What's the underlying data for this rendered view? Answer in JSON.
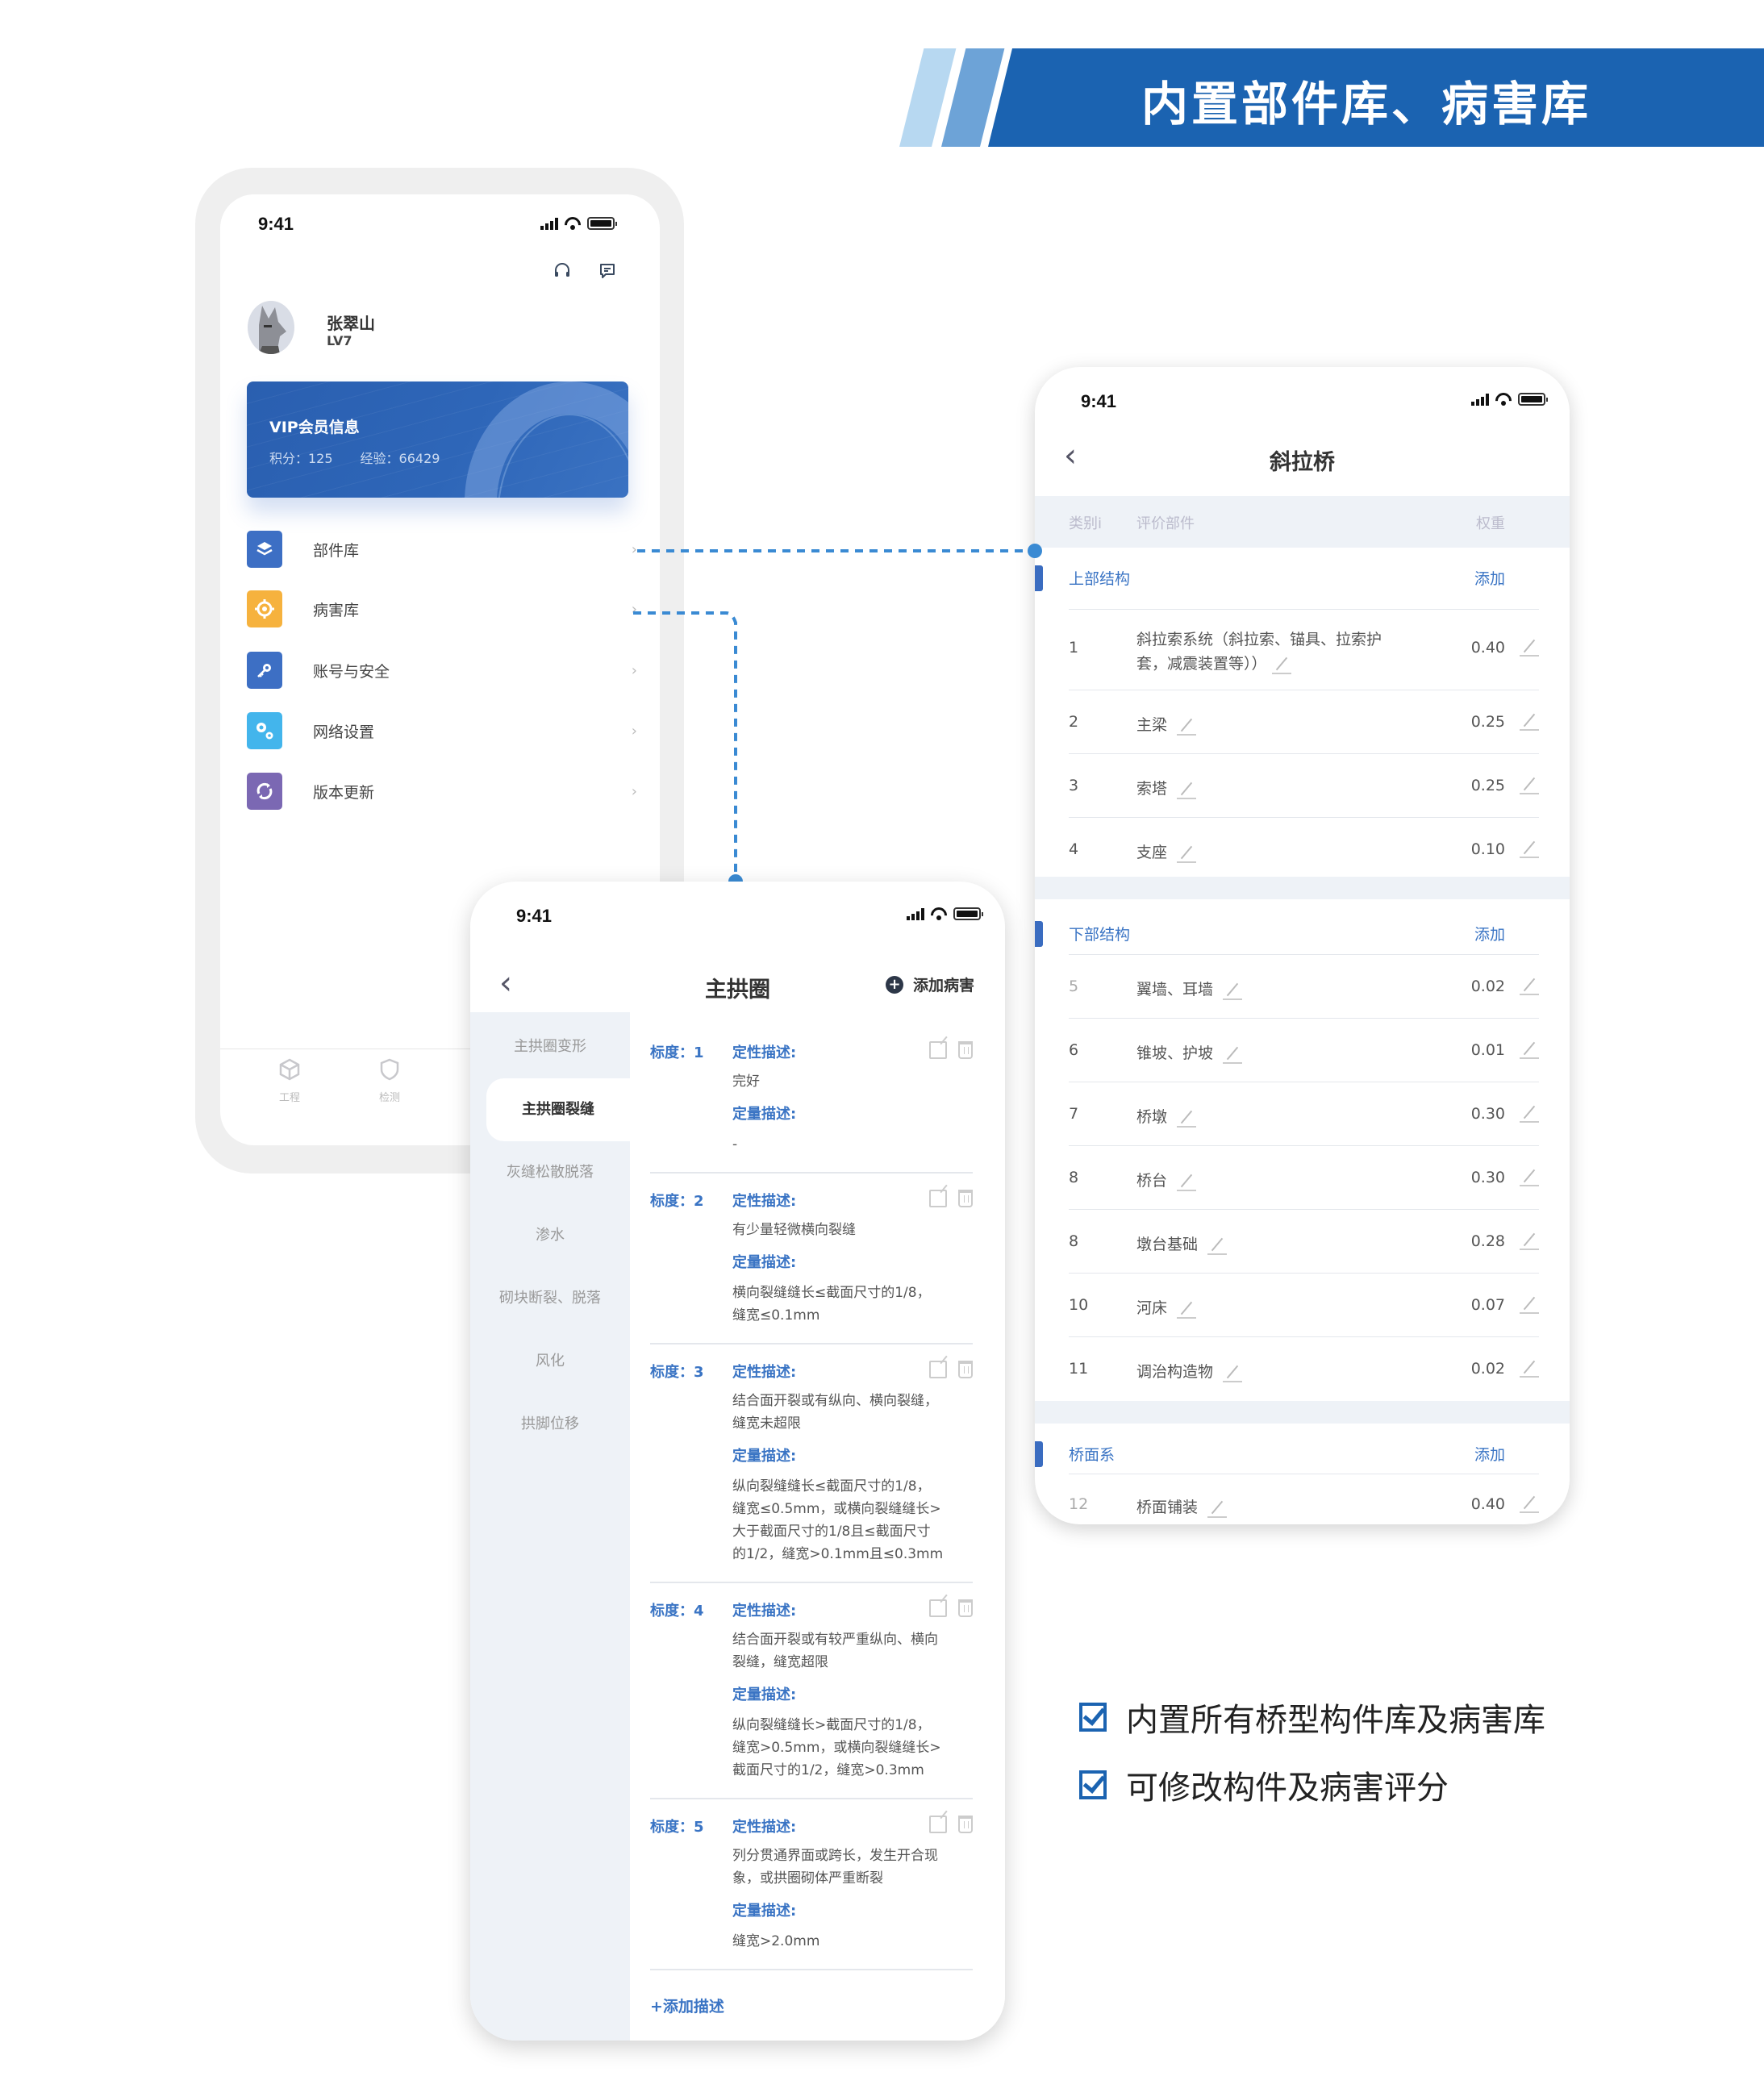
{
  "banner": {
    "title": "内置部件库、病害库"
  },
  "status_bar": {
    "time": "9:41"
  },
  "profile_screen": {
    "user": {
      "name": "张翠山",
      "level": "LV7"
    },
    "top_icons": [
      "headset-icon",
      "message-icon"
    ],
    "vip_card": {
      "title": "VIP会员信息",
      "points": "积分：125",
      "experience": "经验：66429"
    },
    "menu": [
      {
        "label": "部件库",
        "icon": "layers-icon",
        "color": "#3d6fc4"
      },
      {
        "label": "病害库",
        "icon": "target-icon",
        "color": "#f6b23e"
      },
      {
        "label": "账号与安全",
        "icon": "key-icon",
        "color": "#3d6fc4"
      },
      {
        "label": "网络设置",
        "icon": "gears-icon",
        "color": "#43b5ec"
      },
      {
        "label": "版本更新",
        "icon": "refresh-icon",
        "color": "#7b68b3"
      }
    ],
    "tabbar": [
      {
        "label": "工程",
        "icon": "cube-icon"
      },
      {
        "label": "检测",
        "icon": "shield-icon"
      }
    ]
  },
  "component_screen": {
    "title": "斜拉桥",
    "columns": {
      "category": "类别i",
      "component": "评价部件",
      "weight": "权重"
    },
    "add_label": "添加",
    "sections": [
      {
        "name": "上部结构",
        "rows": [
          {
            "no": "1",
            "name": "斜拉索系统（斜拉索、锚具、拉索护套，减震装置等））",
            "name_line1": "斜拉索系统（斜拉索、锚具、拉索护",
            "name_line2": "套，减震装置等））",
            "weight": "0.40"
          },
          {
            "no": "2",
            "name": "主梁",
            "weight": "0.25"
          },
          {
            "no": "3",
            "name": "索塔",
            "weight": "0.25"
          },
          {
            "no": "4",
            "name": "支座",
            "weight": "0.10"
          }
        ]
      },
      {
        "name": "下部结构",
        "rows": [
          {
            "no": "5",
            "name": "翼墙、耳墙",
            "weight": "0.02"
          },
          {
            "no": "6",
            "name": "锥坡、护坡",
            "weight": "0.01"
          },
          {
            "no": "7",
            "name": "桥墩",
            "weight": "0.30"
          },
          {
            "no": "8",
            "name": "桥台",
            "weight": "0.30"
          },
          {
            "no": "8",
            "name": "墩台基础",
            "weight": "0.28"
          },
          {
            "no": "10",
            "name": "河床",
            "weight": "0.07"
          },
          {
            "no": "11",
            "name": "调治构造物",
            "weight": "0.02"
          }
        ]
      },
      {
        "name": "桥面系",
        "rows": [
          {
            "no": "12",
            "name": "桥面铺装",
            "weight": "0.40"
          }
        ]
      }
    ]
  },
  "disease_screen": {
    "title": "主拱圈",
    "add_disease": "添加病害",
    "categories": [
      "主拱圈变形",
      "主拱圈裂缝",
      "灰缝松散脱落",
      "渗水",
      "砌块断裂、脱落",
      "风化",
      "拱脚位移"
    ],
    "active_category": "主拱圈裂缝",
    "qual_label": "定性描述:",
    "quant_label": "定量描述:",
    "entries": [
      {
        "degree": "标度：1",
        "qual": [
          "完好"
        ],
        "quant": [
          "-"
        ]
      },
      {
        "degree": "标度：2",
        "qual": [
          "有少量轻微横向裂缝"
        ],
        "quant": [
          "横向裂缝缝长≤截面尺寸的1/8，",
          "缝宽≤0.1mm"
        ]
      },
      {
        "degree": "标度：3",
        "qual": [
          "结合面开裂或有纵向、横向裂缝，",
          "缝宽未超限"
        ],
        "quant": [
          "纵向裂缝缝长≤截面尺寸的1/8，",
          "缝宽≤0.5mm，或横向裂缝缝长>",
          "大于截面尺寸的1/8且≤截面尺寸",
          "的1/2，缝宽>0.1mm且≤0.3mm"
        ]
      },
      {
        "degree": "标度：4",
        "qual": [
          "结合面开裂或有较严重纵向、横向",
          "裂缝，缝宽超限"
        ],
        "quant": [
          "纵向裂缝缝长>截面尺寸的1/8，",
          "缝宽>0.5mm，或横向裂缝缝长>",
          "截面尺寸的1/2，缝宽>0.3mm"
        ]
      },
      {
        "degree": "标度：5",
        "qual": [
          "列分贯通界面或跨长，发生开合现",
          "象，或拱圈砌体严重断裂"
        ],
        "quant": [
          "缝宽>2.0mm"
        ]
      }
    ],
    "add_description": "+添加描述"
  },
  "features": [
    "内置所有桥型构件库及病害库",
    "可修改构件及病害评分"
  ],
  "colors": {
    "brand_blue": "#1b63b1",
    "accent_blue": "#3a74c4",
    "connector_blue": "#3a8ad3",
    "panel_bg": "#eef2f7"
  }
}
